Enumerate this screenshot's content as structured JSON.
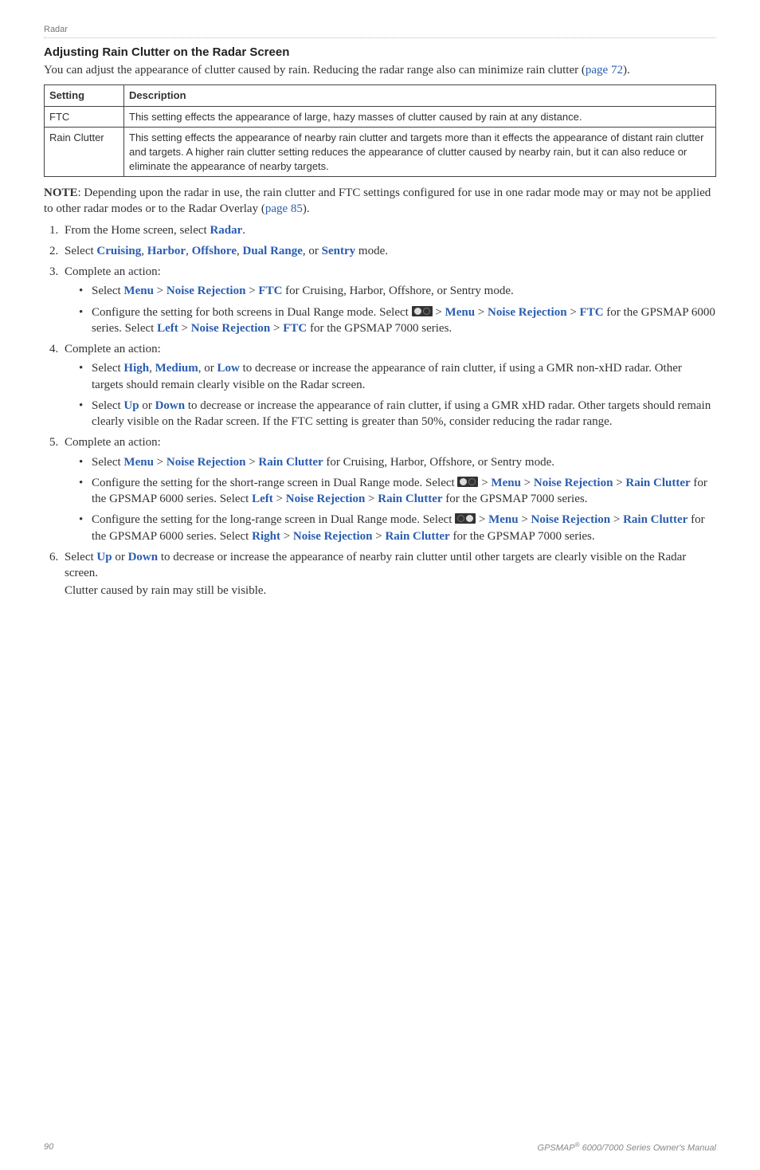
{
  "header": {
    "section": "Radar"
  },
  "title": "Adjusting Rain Clutter on the Radar Screen",
  "intro": {
    "text_a": "You can adjust the appearance of clutter caused by rain. Reducing the radar range also can minimize rain clutter (",
    "link": "page 72",
    "text_b": ")."
  },
  "table": {
    "headers": {
      "setting": "Setting",
      "description": "Description"
    },
    "rows": [
      {
        "setting": "FTC",
        "description": "This setting effects the appearance of large, hazy masses of clutter caused by rain at any distance."
      },
      {
        "setting": "Rain Clutter",
        "description": "This setting effects the appearance of nearby rain clutter and targets more than it effects the appearance of distant rain clutter and targets. A higher rain clutter setting reduces the appearance of clutter caused by nearby rain, but it can also reduce or eliminate the appearance of nearby targets."
      }
    ]
  },
  "note": {
    "label": "NOTE",
    "text_a": ": Depending upon the radar in use, the rain clutter and FTC settings configured for use in one radar mode may or may not be applied to other radar modes or to the Radar Overlay (",
    "link": "page 85",
    "text_b": ")."
  },
  "steps": {
    "s1": {
      "a": "From the Home screen, select ",
      "radar": "Radar",
      "b": "."
    },
    "s2": {
      "a": "Select ",
      "cruising": "Cruising",
      "harbor": "Harbor",
      "offshore": "Offshore",
      "dual": "Dual Range",
      "or": ", or ",
      "sentry": "Sentry",
      "b": " mode."
    },
    "s3": {
      "a": "Complete an action:",
      "b1": {
        "a": "Select ",
        "menu": "Menu",
        "gt1": " > ",
        "nr": "Noise Rejection",
        "gt2": " > ",
        "ftc": "FTC",
        "b": " for Cruising, Harbor, Offshore, or Sentry mode."
      },
      "b2": {
        "a": "Configure the setting for both screens in Dual Range mode. Select ",
        "gt1": " > ",
        "menu": "Menu",
        "gt2": " > ",
        "nr": "Noise Rejection",
        "gt3": " > ",
        "ftc": "FTC",
        "b": " for the GPSMAP 6000 series. Select ",
        "left": "Left",
        "gt4": " > ",
        "nr2": "Noise Rejection",
        "gt5": " > ",
        "ftc2": "FTC",
        "c": " for the GPSMAP 7000 series."
      }
    },
    "s4": {
      "a": "Complete an action:",
      "b1": {
        "a": "Select ",
        "high": "High",
        "c1": ", ",
        "medium": "Medium",
        "c2": ", or ",
        "low": "Low",
        "b": " to decrease or increase the appearance of rain clutter, if using a GMR non-xHD radar. Other targets should remain clearly visible on the Radar screen."
      },
      "b2": {
        "a": "Select ",
        "up": "Up",
        "or": " or ",
        "down": "Down",
        "b": " to decrease or increase the appearance of rain clutter, if using a GMR xHD radar. Other targets should remain clearly visible on the Radar screen. If the FTC setting is greater than 50%, consider reducing the radar range."
      }
    },
    "s5": {
      "a": "Complete an action:",
      "b1": {
        "a": "Select ",
        "menu": "Menu",
        "gt1": " > ",
        "nr": "Noise Rejection",
        "gt2": " > ",
        "rc": "Rain Clutter",
        "b": " for Cruising, Harbor, Offshore, or Sentry mode."
      },
      "b2": {
        "a": "Configure the setting for the short-range screen in Dual Range mode. Select ",
        "gt1": " > ",
        "menu": "Menu",
        "gt2": " > ",
        "nr": "Noise Rejection",
        "gt3": " > ",
        "rc": "Rain Clutter",
        "b": " for the GPSMAP 6000 series. Select ",
        "left": "Left",
        "gt4": " > ",
        "nr2": "Noise Rejection",
        "gt5": " > ",
        "rc2": "Rain Clutter",
        "c": " for the GPSMAP 7000 series."
      },
      "b3": {
        "a": "Configure the setting for the long-range screen in Dual Range mode. Select ",
        "gt1": " > ",
        "menu": "Menu",
        "gt2": " > ",
        "nr": "Noise Rejection",
        "gt3": " > ",
        "rc": "Rain Clutter",
        "b": " for the GPSMAP 6000 series. Select ",
        "right": "Right",
        "gt4": " > ",
        "nr2": "Noise Rejection",
        "gt5": " > ",
        "rc2": "Rain Clutter",
        "c": " for the GPSMAP 7000 series."
      }
    },
    "s6": {
      "a": "Select ",
      "up": "Up",
      "or": " or ",
      "down": "Down",
      "b": " to decrease or increase the appearance of nearby rain clutter until other targets are clearly visible on the Radar screen.",
      "c": "Clutter caused by rain may still be visible."
    }
  },
  "footer": {
    "page": "90",
    "product_a": "GPSMAP",
    "reg": "®",
    "product_b": " 6000/7000 Series Owner's Manual"
  }
}
